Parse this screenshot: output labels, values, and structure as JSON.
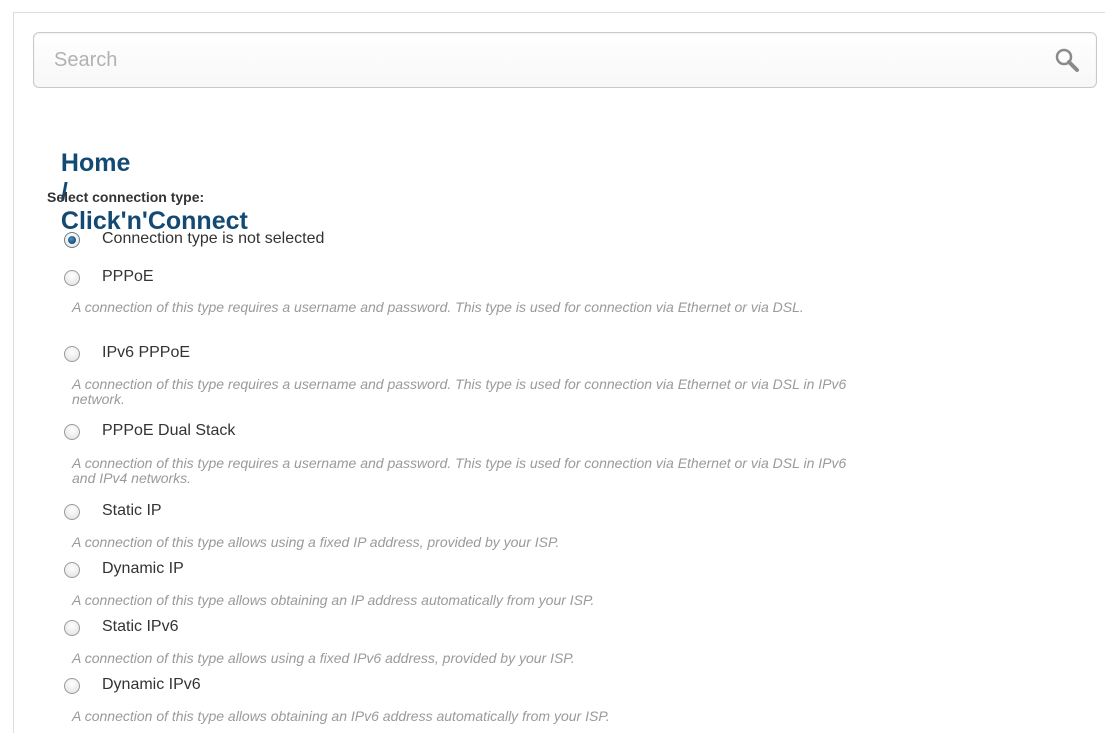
{
  "search": {
    "placeholder": "Search",
    "value": ""
  },
  "breadcrumb": {
    "home": "Home",
    "separator": "/",
    "current": "Click'n'Connect"
  },
  "connection": {
    "section_label": "Select connection type:",
    "selected_index": 0,
    "options": [
      {
        "label": "Connection type is not selected",
        "description": ""
      },
      {
        "label": "PPPoE",
        "description": "A connection of this type requires a username and password. This type is used for connection via Ethernet or via DSL."
      },
      {
        "label": "IPv6 PPPoE",
        "description": "A connection of this type requires a username and password. This type is used for connection via Ethernet or via DSL in IPv6 network."
      },
      {
        "label": "PPPoE Dual Stack",
        "description": "A connection of this type requires a username and password. This type is used for connection via Ethernet or via DSL in IPv6 and IPv4 networks."
      },
      {
        "label": "Static IP",
        "description": "A connection of this type allows using a fixed IP address, provided by your ISP."
      },
      {
        "label": "Dynamic IP",
        "description": "A connection of this type allows obtaining an IP address automatically from your ISP."
      },
      {
        "label": "Static IPv6",
        "description": "A connection of this type allows using a fixed IPv6 address, provided by your ISP."
      },
      {
        "label": "Dynamic IPv6",
        "description": "A connection of this type allows obtaining an IPv6 address automatically from your ISP."
      }
    ]
  },
  "colors": {
    "title": "#134a73",
    "radio_selected": "#1d4f78",
    "description_text": "#9a9a9a"
  },
  "icons": {
    "search": "search-icon"
  }
}
